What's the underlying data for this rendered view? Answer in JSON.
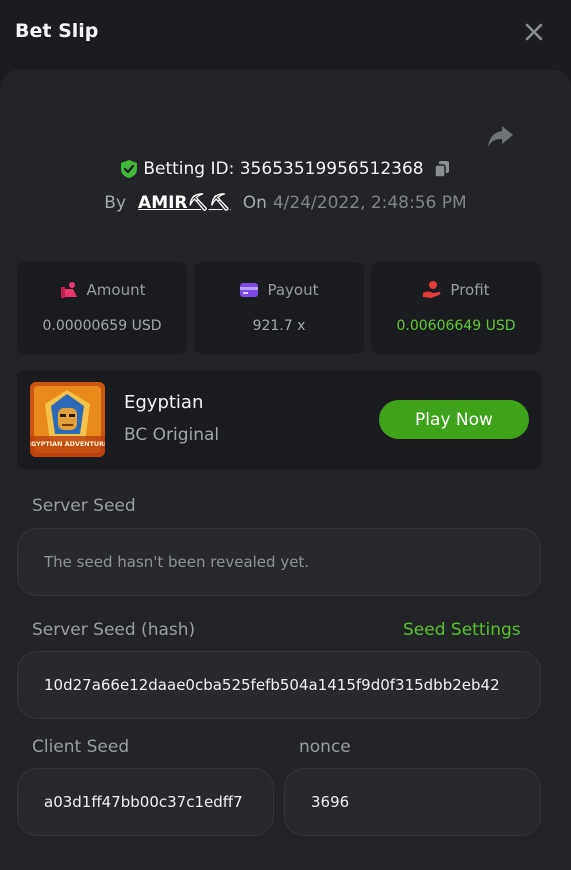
{
  "header": {
    "title": "Bet Slip"
  },
  "bet": {
    "betting_id_text": "Betting ID: 35653519956512368",
    "by_label": "By",
    "user": "AMIR⛏⛏",
    "on_label": "On",
    "date": "4/24/2022, 2:48:56 PM"
  },
  "stats": {
    "amount": {
      "label": "Amount",
      "value": "0.00000659 USD"
    },
    "payout": {
      "label": "Payout",
      "value": "921.7 x"
    },
    "profit": {
      "label": "Profit",
      "value": "0.00606649 USD"
    }
  },
  "game": {
    "name": "Egyptian",
    "provider": "BC Original",
    "thumb_caption": "EGYPTIAN ADVENTURE",
    "play_label": "Play Now"
  },
  "seeds": {
    "server_seed_label": "Server Seed",
    "server_seed_value": "The seed hasn't been revealed yet.",
    "server_hash_label": "Server Seed (hash)",
    "seed_settings_label": "Seed Settings",
    "server_hash_value": "10d27a66e12daae0cba525fefb504a1415f9d0f315dbb2eb42",
    "client_seed_label": "Client Seed",
    "client_seed_value": "a03d1ff47bb00c37c1edff7",
    "nonce_label": "nonce",
    "nonce_value": "3696"
  },
  "colors": {
    "background": "#1b1c1f",
    "panel": "#232427",
    "accent_green": "#3ea31b",
    "profit_green": "#5fcb32"
  },
  "icons": {
    "close": "close-icon",
    "share": "share-icon",
    "verified": "shield-check-icon",
    "copy": "copy-icon",
    "amount": "coins-icon",
    "payout": "wallet-icon",
    "profit": "hand-coin-icon"
  }
}
